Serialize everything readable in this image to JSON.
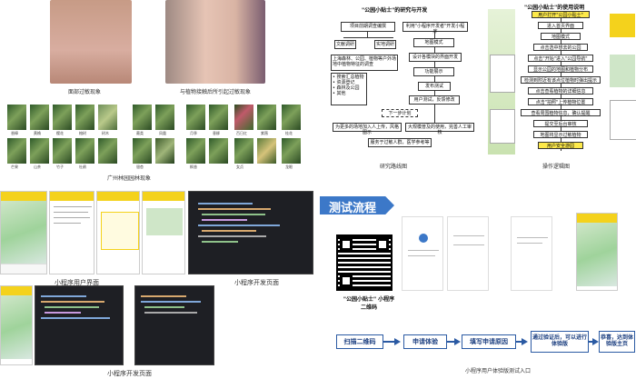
{
  "top_left": {
    "photo_left_caption": "面部过敏现象",
    "photo_right_caption": "与植物接触后所引起过敏现象",
    "plants_caption": "广州林园园林现象",
    "plant_labels": [
      "香樟",
      "黄桷",
      "樱花",
      "榕树",
      "树木",
      "蕨类",
      "凤凰",
      "月季",
      "垂柳",
      "百日红",
      "紫薇",
      "桂花",
      "芒果",
      "山茶",
      "竹子",
      "杜鹃",
      "银杏",
      "枫香",
      "女贞",
      "龙眼"
    ]
  },
  "top_mid": {
    "title": "\"公园小贴士\"的研究与开发",
    "caption": "研究路线图",
    "nodes": [
      "项目前期调查编撰",
      "文献调研",
      "实地调研",
      "上海森林、公园、植物等户外场地中植物特征的调查",
      "• 搜索汇总植物\n• 资源登记\n• 森林及公园\n• 其他",
      "利用\"小程序开发者\"开发小程序",
      "地图模式",
      "设计各模块的界面开发",
      "功能展示",
      "发布测试",
      "用户测试，反馈修改",
      "下一步计划",
      "为更多的场地加入人上传，风格图示",
      "大规模普及的使用，完善人工审核",
      "服务于过敏人群，医学参考等"
    ]
  },
  "top_right": {
    "title": "\"公园小贴士\"的使用说明",
    "caption": "操作逻辑图",
    "steps": [
      "用户打开\"公园小贴士\"",
      "进入首页界面",
      "地图模式",
      "点击选中想去的公园",
      "点击\"开始\"进入\"公园导航\"",
      "显示公园的地图和植物分布",
      "检测到附近有该点位植物时弹出提示",
      "点击查看植物的详细信息",
      "点击\"拍照\"上传植物位置",
      "查看周围植物信息，确认提醒",
      "提交至后台审核",
      "地图将显示过敏植物",
      "用户安全游园"
    ]
  },
  "bottom_left": {
    "user_ui_caption": "小程序用户界面",
    "dev_caption_1": "小程序开发页面",
    "dev_caption_2": "小程序开发页面"
  },
  "bottom_right": {
    "banner": "测试流程",
    "qr_caption": "\"公园小贴士\" 小程序\n二维码",
    "caption": "小程序用户体验版测试入口",
    "flow": [
      "扫描二维码",
      "申请体验",
      "填写申请原因",
      "通过验证后，可以进行体验版",
      "恭喜，达到体验版主页"
    ]
  },
  "colors": {
    "accent_yellow": "#f4d21c",
    "flow_blue": "#2b5aa3",
    "banner_blue": "#3c78c8",
    "dark_ide": "#1e1f24"
  }
}
